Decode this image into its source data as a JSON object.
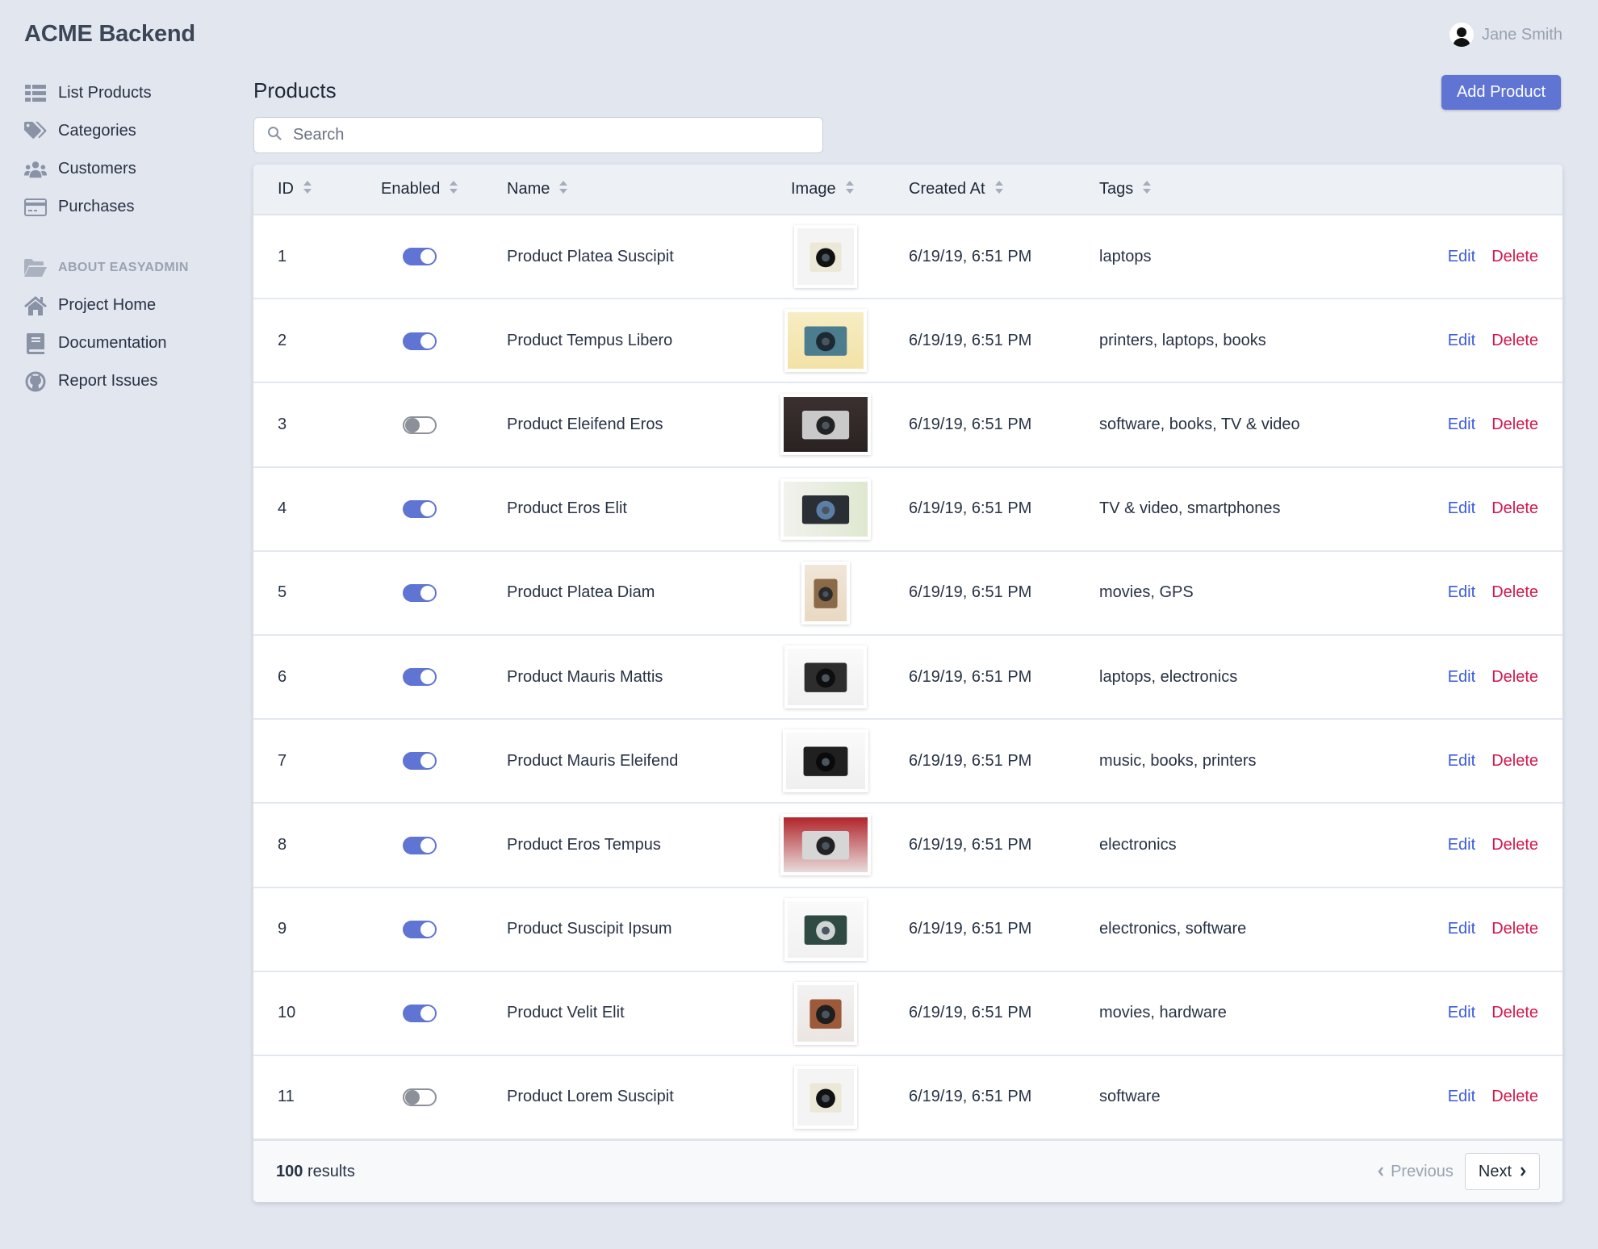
{
  "app": {
    "brand": "ACME Backend"
  },
  "user": {
    "name": "Jane Smith",
    "avatar_icon": "user-silhouette-icon"
  },
  "sidebar": {
    "items": [
      {
        "label": "List Products",
        "icon": "list-icon"
      },
      {
        "label": "Categories",
        "icon": "tags-icon"
      },
      {
        "label": "Customers",
        "icon": "users-icon"
      },
      {
        "label": "Purchases",
        "icon": "credit-card-icon"
      }
    ],
    "section": {
      "label": "ABOUT EASYADMIN",
      "icon": "folder-open-icon"
    },
    "about_items": [
      {
        "label": "Project Home",
        "icon": "home-icon"
      },
      {
        "label": "Documentation",
        "icon": "book-icon"
      },
      {
        "label": "Report Issues",
        "icon": "github-icon"
      }
    ]
  },
  "page": {
    "title": "Products",
    "add_button": "Add Product",
    "search_placeholder": "Search",
    "search_value": ""
  },
  "table": {
    "columns": [
      "ID",
      "Enabled",
      "Name",
      "Image",
      "Created At",
      "Tags"
    ],
    "action_labels": {
      "edit": "Edit",
      "delete": "Delete"
    },
    "rows": [
      {
        "id": "1",
        "enabled": true,
        "name": "Product Platea Suscipit",
        "image": "instant-camera-white",
        "created_at": "6/19/19, 6:51 PM",
        "tags": "laptops"
      },
      {
        "id": "2",
        "enabled": true,
        "name": "Product Tempus Libero",
        "image": "blue-compact-camera",
        "created_at": "6/19/19, 6:51 PM",
        "tags": "printers, laptops, books"
      },
      {
        "id": "3",
        "enabled": false,
        "name": "Product Eleifend Eros",
        "image": "twin-lens-camera-dark",
        "created_at": "6/19/19, 6:51 PM",
        "tags": "software, books, TV & video"
      },
      {
        "id": "4",
        "enabled": true,
        "name": "Product Eros Elit",
        "image": "twin-lens-camera-window",
        "created_at": "6/19/19, 6:51 PM",
        "tags": "TV & video, smartphones"
      },
      {
        "id": "5",
        "enabled": true,
        "name": "Product Platea Diam",
        "image": "brown-twin-lens-camera",
        "created_at": "6/19/19, 6:51 PM",
        "tags": "movies, GPS"
      },
      {
        "id": "6",
        "enabled": true,
        "name": "Product Mauris Mattis",
        "image": "silver-slr-camera",
        "created_at": "6/19/19, 6:51 PM",
        "tags": "laptops, electronics"
      },
      {
        "id": "7",
        "enabled": true,
        "name": "Product Mauris Eleifend",
        "image": "black-slr-camera",
        "created_at": "6/19/19, 6:51 PM",
        "tags": "music, books, printers"
      },
      {
        "id": "8",
        "enabled": true,
        "name": "Product Eros Tempus",
        "image": "rangefinder-camera-red",
        "created_at": "6/19/19, 6:51 PM",
        "tags": "electronics"
      },
      {
        "id": "9",
        "enabled": true,
        "name": "Product Suscipit Ipsum",
        "image": "green-compact-camera",
        "created_at": "6/19/19, 6:51 PM",
        "tags": "electronics, software"
      },
      {
        "id": "10",
        "enabled": true,
        "name": "Product Velit Elit",
        "image": "box-camera-hand",
        "created_at": "6/19/19, 6:51 PM",
        "tags": "movies, hardware"
      },
      {
        "id": "11",
        "enabled": false,
        "name": "Product Lorem Suscipit",
        "image": "instant-camera-white",
        "created_at": "6/19/19, 6:51 PM",
        "tags": "software"
      }
    ]
  },
  "footer": {
    "results_count": "100",
    "results_label": "results",
    "previous_label": "Previous",
    "next_label": "Next"
  },
  "colors": {
    "accent": "#5f74d3",
    "edit_link": "#3b5bdb",
    "delete_link": "#d3164a",
    "background": "#e2e6ef"
  }
}
